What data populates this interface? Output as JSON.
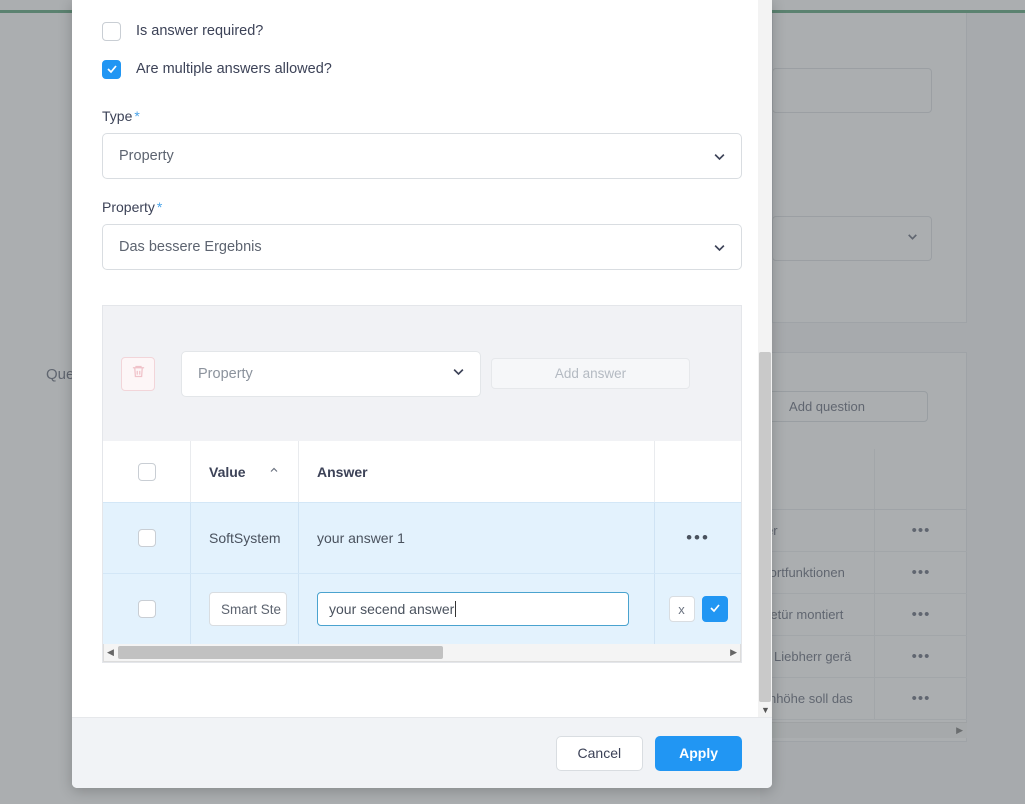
{
  "background": {
    "questions_label": "Que",
    "add_question_button": "Add question",
    "accent_line_color": "#2e8b57",
    "table_rows": [
      {
        "text": "",
        "actions": ""
      },
      {
        "text": "n her",
        "actions": "•••"
      },
      {
        "text": "omfortfunktionen",
        "actions": "•••"
      },
      {
        "text": "erätetür montiert",
        "actions": "•••"
      },
      {
        "text": "f Ihr Liebherr gerä",
        "actions": "•••"
      },
      {
        "text": "chenhöhe soll das",
        "actions": "•••"
      }
    ]
  },
  "modal": {
    "checkboxes": [
      {
        "label": "Is answer required?",
        "checked": false
      },
      {
        "label": "Are multiple answers allowed?",
        "checked": true
      }
    ],
    "fields": [
      {
        "label": "Type",
        "required_marker": "*",
        "value": "Property"
      },
      {
        "label": "Property",
        "required_marker": "*",
        "value": "Das bessere Ergebnis"
      }
    ],
    "answers_panel": {
      "delete_icon": "trash-icon",
      "select_placeholder": "Property",
      "add_answer_button": "Add answer"
    },
    "answers_table": {
      "columns": [
        "",
        "Value",
        "Answer",
        ""
      ],
      "sort_column": "Value",
      "sort_direction": "asc",
      "sort_caret": "⌃",
      "rows": [
        {
          "mode": "display",
          "checked": false,
          "value": "SoftSystem",
          "answer": "your answer 1",
          "actions": "•••"
        },
        {
          "mode": "edit",
          "checked": false,
          "value": "Smart Ste",
          "answer": "your secend answer",
          "cancel_label": "x",
          "confirm_label": "check-icon"
        }
      ]
    },
    "footer": {
      "cancel_label": "Cancel",
      "apply_label": "Apply"
    }
  },
  "colors": {
    "accent_blue": "#2196f3",
    "row_highlight": "#e3f2fd",
    "required_star": "#4aa3e8",
    "danger_light": "#f2d5d9",
    "green_line": "#2e8b57"
  }
}
